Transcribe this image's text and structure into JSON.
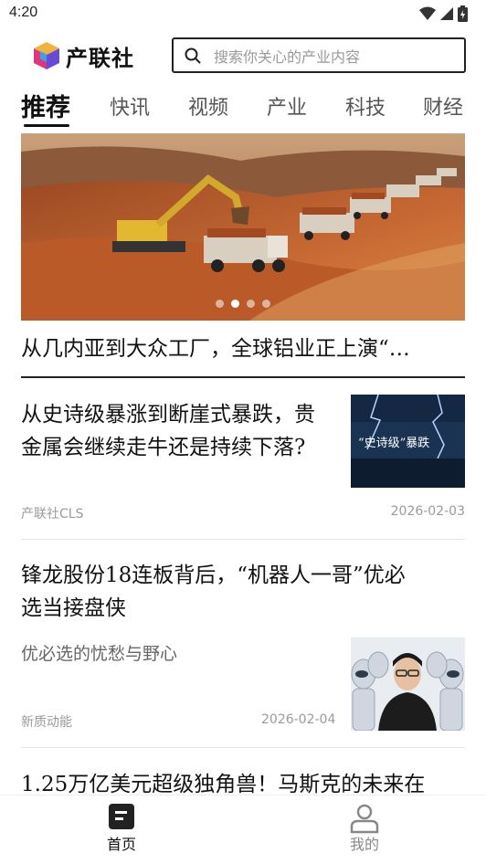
{
  "status_bar": {
    "time": "4:20"
  },
  "header": {
    "app_name": "产联社",
    "search_placeholder": "搜索你关心的产业内容"
  },
  "tabs": [
    {
      "label": "推荐",
      "active": true
    },
    {
      "label": "快讯"
    },
    {
      "label": "视频"
    },
    {
      "label": "产业"
    },
    {
      "label": "科技"
    },
    {
      "label": "财经"
    }
  ],
  "banner": {
    "title": "从几内亚到大众工厂，全球铝业正上演“…",
    "slide_count": 4,
    "active_slide": 2
  },
  "articles": [
    {
      "title_line1": "从史诗级暴涨到断崖式暴跌，贵",
      "title_line2": "金属会继续走牛还是持续下落?",
      "thumb_text": "“史诗级”暴跌",
      "source": "产联社CLS",
      "date": "2026-02-03"
    },
    {
      "title_line1": "锋龙股份18连板背后，“机器人一哥”优必",
      "title_line2": "选当接盘侠",
      "subtitle": "优必选的忧愁与野心",
      "source": "新质动能",
      "date": "2026-02-04"
    },
    {
      "title_line1": "1.25万亿美元超级独角兽！马斯克的未来在"
    }
  ],
  "bottom_nav": [
    {
      "label": "首页",
      "active": true,
      "icon": "home-icon"
    },
    {
      "label": "我的",
      "active": false,
      "icon": "profile-icon"
    }
  ],
  "colors": {
    "active_text": "#111111",
    "inactive_text": "#888888",
    "accent": "#111111"
  }
}
